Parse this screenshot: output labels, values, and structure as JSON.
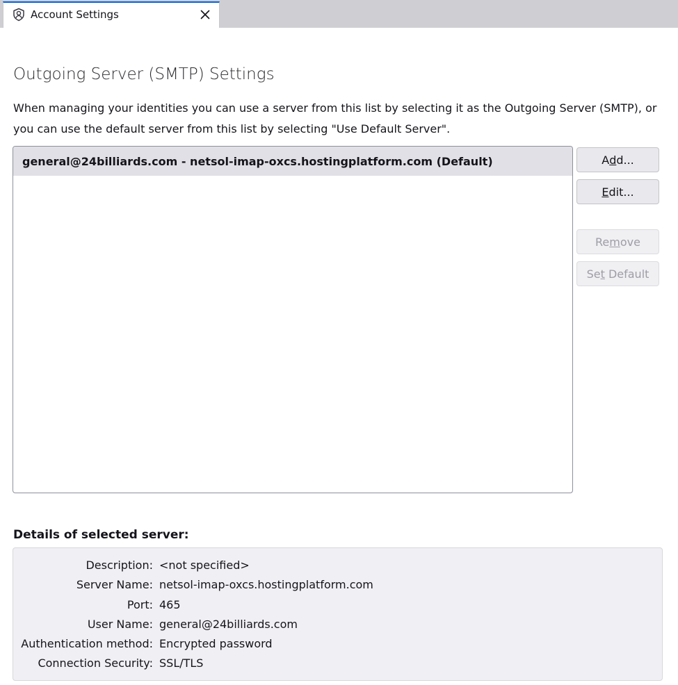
{
  "tab": {
    "label": "Account Settings",
    "icon": "account-settings-icon",
    "close_icon": "close-icon"
  },
  "page": {
    "title": "Outgoing Server (SMTP) Settings",
    "description": "When managing your identities you can use a server from this list by selecting it as the Outgoing Server (SMTP), or you can use the default server from this list by selecting \"Use Default Server\"."
  },
  "servers": [
    {
      "label": "general@24billiards.com - netsol-imap-oxcs.hostingplatform.com (Default)",
      "selected": true
    }
  ],
  "buttons": {
    "add": {
      "pre": "A",
      "key": "d",
      "post": "d...",
      "enabled": true
    },
    "edit": {
      "pre": "",
      "key": "E",
      "post": "dit...",
      "enabled": true
    },
    "remove": {
      "pre": "Re",
      "key": "m",
      "post": "ove",
      "enabled": false
    },
    "set_default": {
      "pre": "Se",
      "key": "t",
      "post": " Default",
      "enabled": false
    }
  },
  "details": {
    "heading": "Details of selected server:",
    "rows": [
      {
        "label": "Description:",
        "value": "<not specified>"
      },
      {
        "label": "Server Name:",
        "value": "netsol-imap-oxcs.hostingplatform.com"
      },
      {
        "label": "Port:",
        "value": "465"
      },
      {
        "label": "User Name:",
        "value": "general@24billiards.com"
      },
      {
        "label": "Authentication method:",
        "value": "Encrypted password"
      },
      {
        "label": "Connection Security:",
        "value": "SSL/TLS"
      }
    ]
  },
  "colors": {
    "tab_accent": "#0061e0",
    "selected_row": "#e0e0e6",
    "details_bg": "#f0f0f4"
  }
}
